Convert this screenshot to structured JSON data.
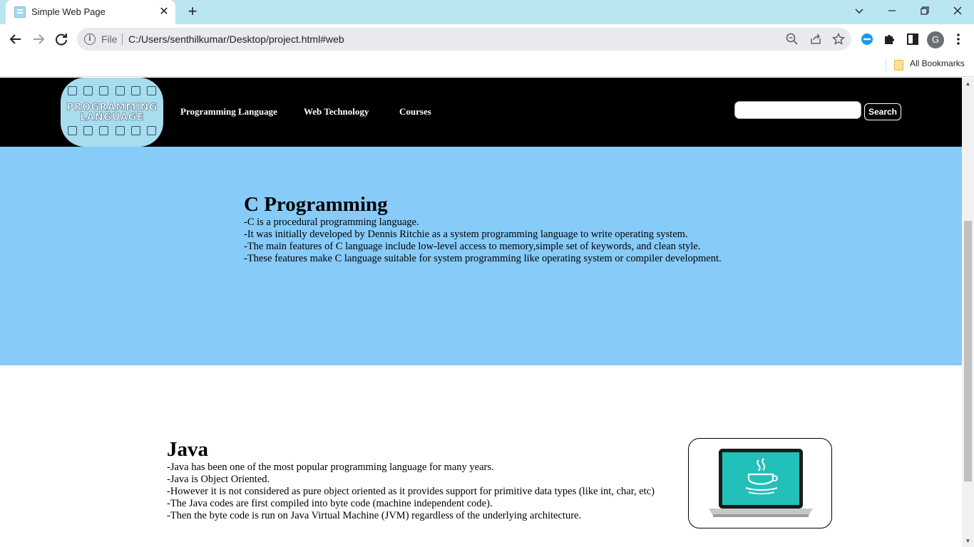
{
  "browser": {
    "tab_title": "Simple Web Page",
    "tab_close": "✕",
    "new_tab": "+",
    "omnibox_scheme": "File",
    "url": "C:/Users/senthilkumar/Desktop/project.html#web",
    "avatar_letter": "G",
    "bookmarks_label": "All Bookmarks"
  },
  "site": {
    "logo_text_line1": "PROGRAMMING",
    "logo_text_line2": "LANGUAGE",
    "nav": [
      {
        "label": "Programming Language"
      },
      {
        "label": "Web Technology"
      },
      {
        "label": "Courses"
      }
    ],
    "search": {
      "value": "",
      "button_label": "Search"
    },
    "colors": {
      "header_bg": "#000000",
      "c_section_bg": "#87cbf8",
      "java_screen": "#23c0b9"
    }
  },
  "c_section": {
    "title": "C Programming",
    "lines": [
      "-C is a procedural programming language.",
      "-It was initially developed by Dennis Ritchie as a system programming language to write operating system.",
      "-The main features of C language include low-level access to memory,simple set of keywords, and clean style.",
      "-These features make C language suitable for system programming like operating system or compiler development."
    ]
  },
  "java_section": {
    "title": "Java",
    "lines": [
      "-Java has been one of the most popular programming language for many years.",
      "-Java is Object Oriented.",
      "-However it is not considered as pure object oriented as it provides support for primitive data types (like int, char, etc)",
      "-The Java codes are first compiled into byte code (machine independent code).",
      "-Then the byte code is run on Java Virtual Machine (JVM) regardless of the underlying architecture."
    ],
    "image_icon": "laptop-java-logo-icon"
  }
}
